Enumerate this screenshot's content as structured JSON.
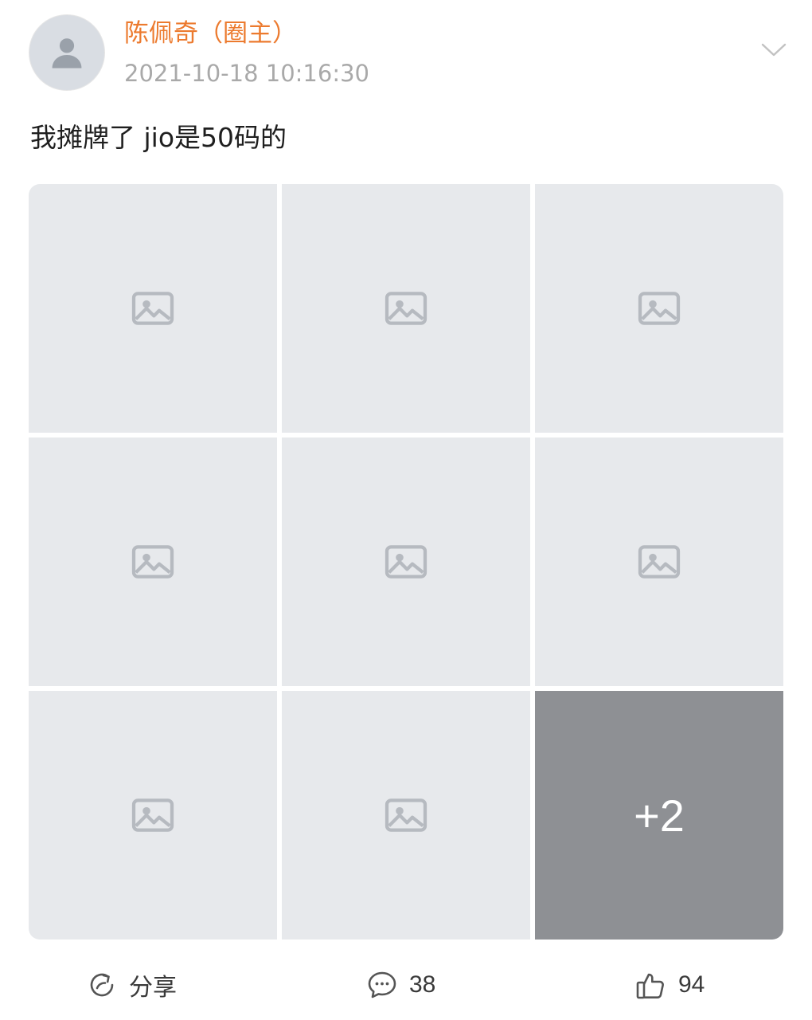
{
  "post": {
    "author": "陈佩奇（圈主）",
    "timestamp": "2021-10-18 10:16:30",
    "text": "我摊牌了 jio是50码的"
  },
  "icons": {
    "avatar": "user-avatar",
    "expand": "chevron-down-icon",
    "photo": "image-placeholder-icon",
    "share": "share-icon",
    "comment": "comment-icon",
    "like": "thumbs-up-icon"
  },
  "photos": {
    "grid_count": 9,
    "more_count": "+2"
  },
  "actions": {
    "share_label": "分享",
    "comment_count": "38",
    "like_count": "94"
  },
  "colors": {
    "author": "#ec7a2e",
    "timestamp": "#a9a9a9",
    "placeholder": "#e7e9ec"
  }
}
